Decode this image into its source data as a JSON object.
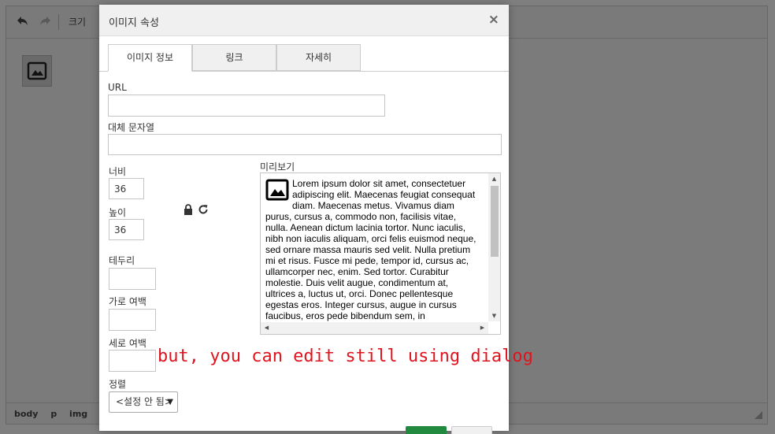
{
  "editor": {
    "toolbar": {
      "size_label": "크기"
    },
    "statusbar": {
      "path": [
        "body",
        "p",
        "img"
      ]
    }
  },
  "dialog": {
    "title": "이미지 속성",
    "close_symbol": "×",
    "tabs": [
      {
        "label": "이미지 정보",
        "active": true
      },
      {
        "label": "링크",
        "active": false
      },
      {
        "label": "자세히",
        "active": false
      }
    ],
    "fields": {
      "url_label": "URL",
      "url_value": "",
      "alt_label": "대체 문자열",
      "alt_value": "",
      "width_label": "너비",
      "width_value": "36",
      "height_label": "높이",
      "height_value": "36",
      "border_label": "테두리",
      "border_value": "",
      "hspace_label": "가로 여백",
      "hspace_value": "",
      "vspace_label": "세로 여백",
      "vspace_value": "",
      "align_label": "정렬",
      "align_value": "<설정 안 됨>"
    },
    "preview": {
      "label": "미리보기",
      "text": "Lorem ipsum dolor sit amet, consectetuer adipiscing elit. Maecenas feugiat consequat diam. Maecenas metus. Vivamus diam purus, cursus a, commodo non, facilisis vitae, nulla. Aenean dictum lacinia tortor. Nunc iaculis, nibh non iaculis aliquam, orci felis euismod neque, sed ornare massa mauris sed velit. Nulla pretium mi et risus. Fusce mi pede, tempor id, cursus ac, ullamcorper nec, enim. Sed tortor. Curabitur molestie. Duis velit augue, condimentum at, ultrices a, luctus ut, orci. Donec pellentesque egestas eros. Integer cursus, augue in cursus faucibus, eros pede bibendum sem, in"
    }
  },
  "annotation": "but, you can edit still using dialog",
  "colors": {
    "annotation": "#e0141e",
    "ok_button": "#218a3e",
    "overlay": "#7f7f7f"
  }
}
